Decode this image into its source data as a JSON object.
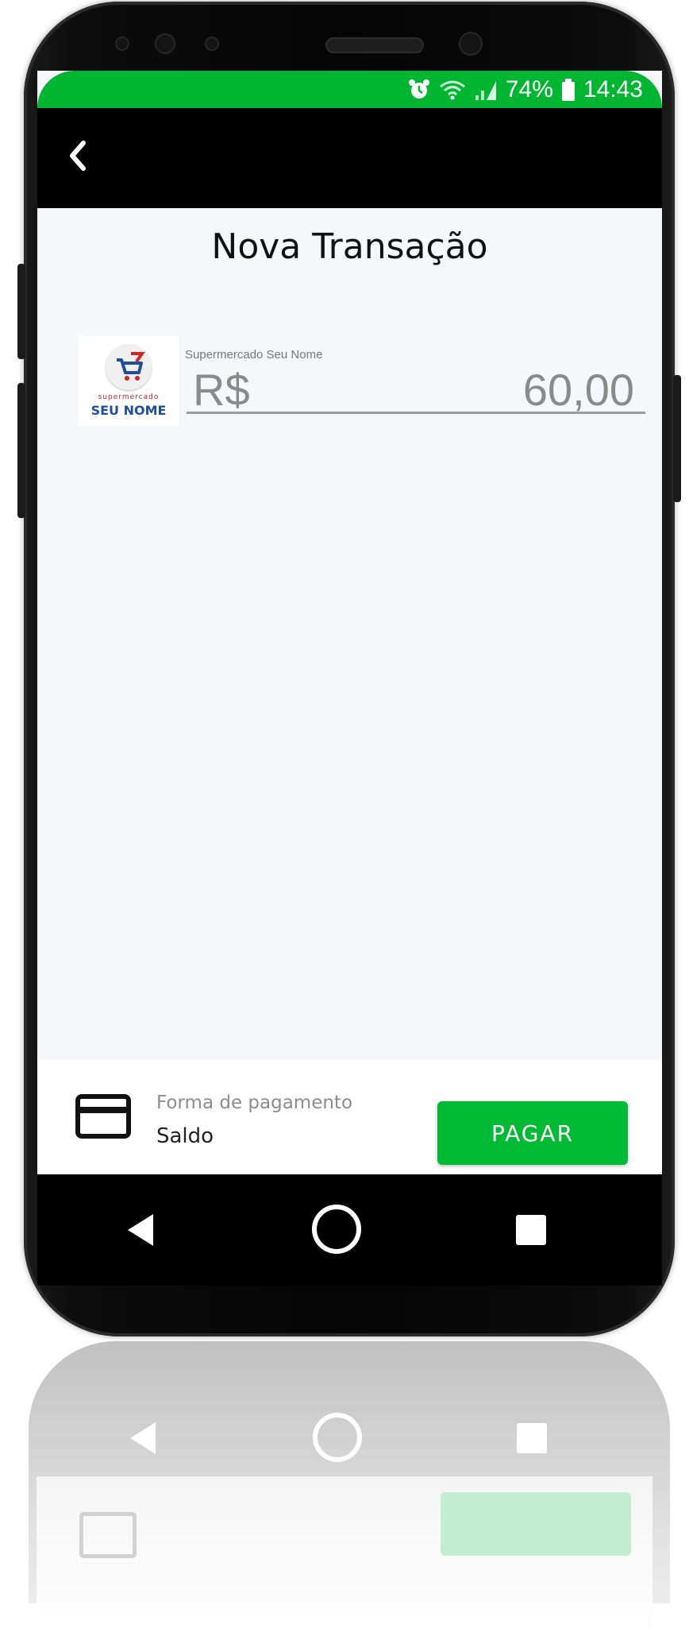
{
  "status_bar": {
    "battery_percent": "74%",
    "time": "14:43",
    "alarm_icon": "alarm-icon",
    "wifi_icon": "wifi-icon",
    "signal_icon": "signal-icon",
    "battery_icon": "battery-icon"
  },
  "app_bar": {
    "back_icon": "chevron-left-icon"
  },
  "page": {
    "title": "Nova Transação"
  },
  "merchant": {
    "logo_line1": "supermercado",
    "logo_line2": "SEU NOME",
    "name": "Supermercado Seu Nome"
  },
  "amount": {
    "currency": "R$",
    "value": "60,00"
  },
  "payment": {
    "label": "Forma de pagamento",
    "method": "Saldo",
    "icon": "credit-card-icon",
    "button_label": "PAGAR"
  },
  "colors": {
    "status_bar": "#00b531",
    "app_bar": "#000000",
    "screen_bg": "#f6f7fb",
    "pay_button": "#00ba35",
    "logo_blue": "#1f4f9a",
    "logo_red": "#d1231f"
  },
  "nav_bar": {
    "back_icon": "triangle-back-icon",
    "home_icon": "circle-home-icon",
    "recents_icon": "square-recents-icon"
  }
}
